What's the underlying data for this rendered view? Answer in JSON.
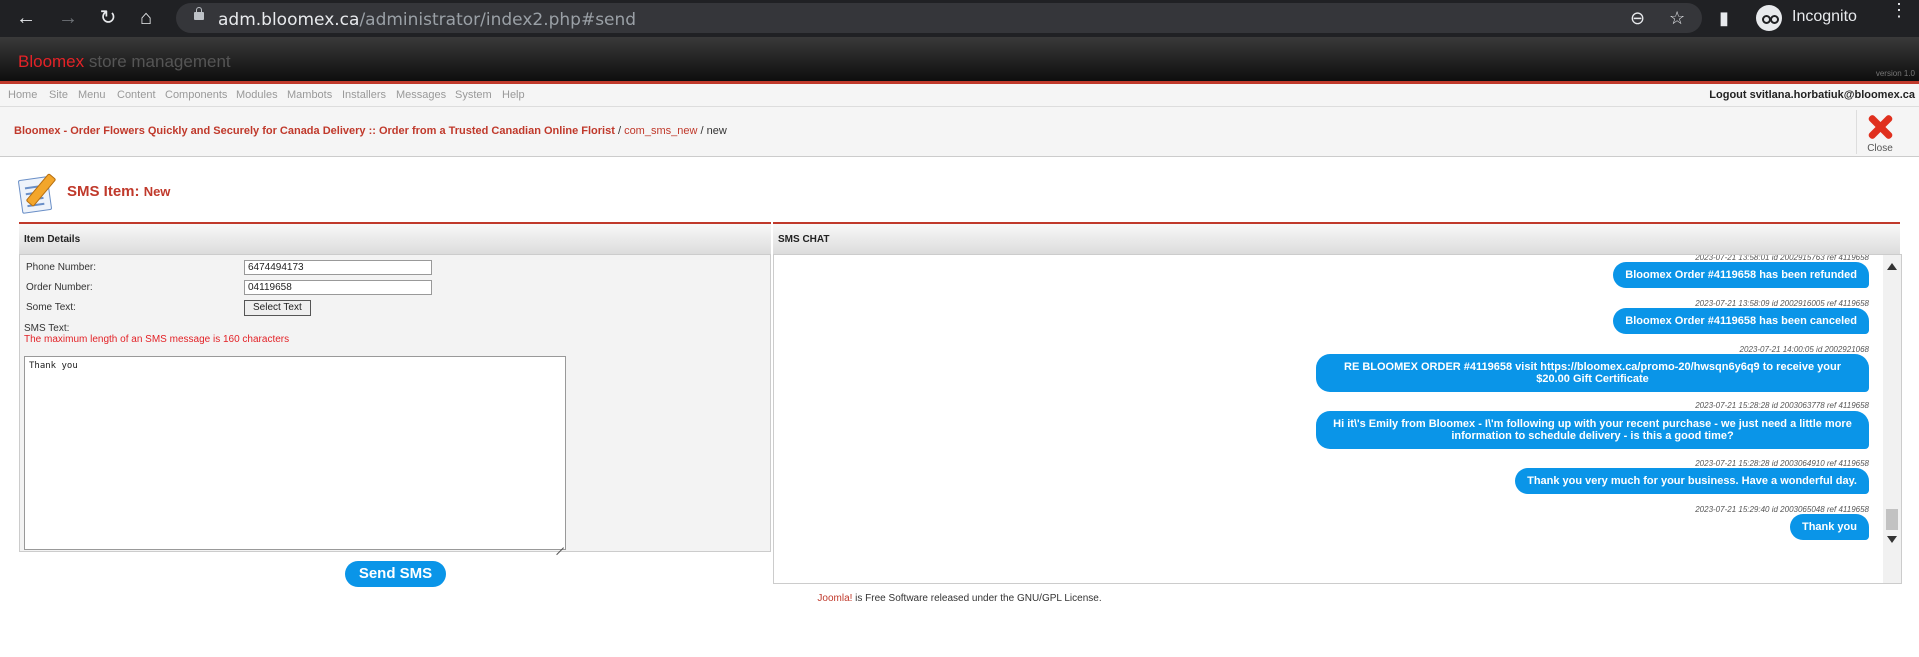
{
  "browser": {
    "url_host": "adm.bloomex.ca",
    "url_path": "/administrator/index2.php#send",
    "profile_label": "Incognito"
  },
  "admin": {
    "brand_part1": "Bloomex",
    "brand_part2": "store management",
    "version": "version 1.0"
  },
  "menu": {
    "items": [
      "Home",
      "Site",
      "Menu",
      "Content",
      "Components",
      "Modules",
      "Mambots",
      "Installers",
      "Messages",
      "System",
      "Help"
    ],
    "logout": "Logout svitlana.horbatiuk@bloomex.ca"
  },
  "breadcrumb": {
    "site": "Bloomex - Order Flowers Quickly and Securely for Canada Delivery :: Order from a Trusted Canadian Online Florist",
    "sep1": " / ",
    "component": "com_sms_new",
    "sep2": " / ",
    "current": "new"
  },
  "toolbar": {
    "close_label": "Close"
  },
  "page": {
    "title": "SMS Item:",
    "subtitle": "New"
  },
  "form": {
    "panel_title": "Item Details",
    "phone_label": "Phone Number:",
    "phone_value": "6474494173",
    "order_label": "Order Number:",
    "order_value": "04119658",
    "some_text_label": "Some Text:",
    "select_text_button": "Select Text",
    "sms_text_label": "SMS Text:",
    "max_length_hint": "The maximum length of an SMS message is 160 characters",
    "sms_text_value": "Thank you",
    "send_button": "Send SMS"
  },
  "chat": {
    "panel_title": "SMS CHAT",
    "messages": [
      {
        "meta": "2023-07-21 13:58:01 id 2002915763 ref 4119658",
        "text": "Bloomex Order #4119658 has been refunded"
      },
      {
        "meta": "2023-07-21 13:58:09 id 2002916005 ref 4119658",
        "text": "Bloomex Order #4119658 has been canceled"
      },
      {
        "meta": "2023-07-21 14:00:05 id 2002921068",
        "line1": "RE BLOOMEX ORDER #4119658 visit https://bloomex.ca/promo-20/hwsqn6y6q9 to receive your",
        "line2": "$20.00 Gift Certificate"
      },
      {
        "meta": "2023-07-21 15:28:28 id 2003063778 ref 4119658",
        "line1": "Hi it\\'s Emily from Bloomex - I\\'m following up with your recent purchase - we just need a little more",
        "line2": "information to schedule delivery - is this a good time?"
      },
      {
        "meta": "2023-07-21 15:28:28 id 2003064910 ref 4119658",
        "text": "Thank you very much for your business. Have a wonderful day."
      },
      {
        "meta": "2023-07-21 15:29:40 id 2003065048 ref 4119658",
        "text": "Thank you"
      }
    ]
  },
  "footer": {
    "joomla_link": "Joomla!",
    "text": " is Free Software released under the GNU/GPL License."
  }
}
